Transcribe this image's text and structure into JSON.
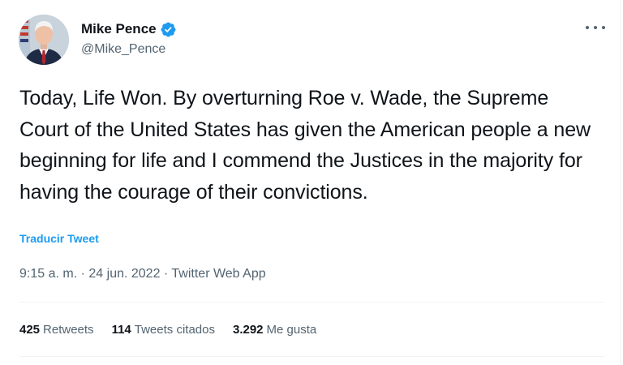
{
  "user": {
    "name": "Mike Pence",
    "handle": "@Mike_Pence",
    "verified_icon": "verified-badge-icon"
  },
  "tweet": {
    "text": "Today, Life Won. By overturning Roe v. Wade, the Supreme Court of the United States has given the American people a new beginning for life and I commend the Justices in the majority for having the courage of their convictions.",
    "translate_label": "Traducir Tweet",
    "time": "9:15 a. m.",
    "separator": "·",
    "date": "24 jun. 2022",
    "app": "Twitter Web App"
  },
  "stats": {
    "retweets": {
      "count": "425",
      "label": "Retweets"
    },
    "quotes": {
      "count": "114",
      "label": "Tweets citados"
    },
    "likes": {
      "count": "3.292",
      "label": "Me gusta"
    }
  },
  "colors": {
    "accent": "#1d9bf0",
    "text": "#0f1419",
    "secondary": "#536471",
    "border": "#eff3f4"
  }
}
